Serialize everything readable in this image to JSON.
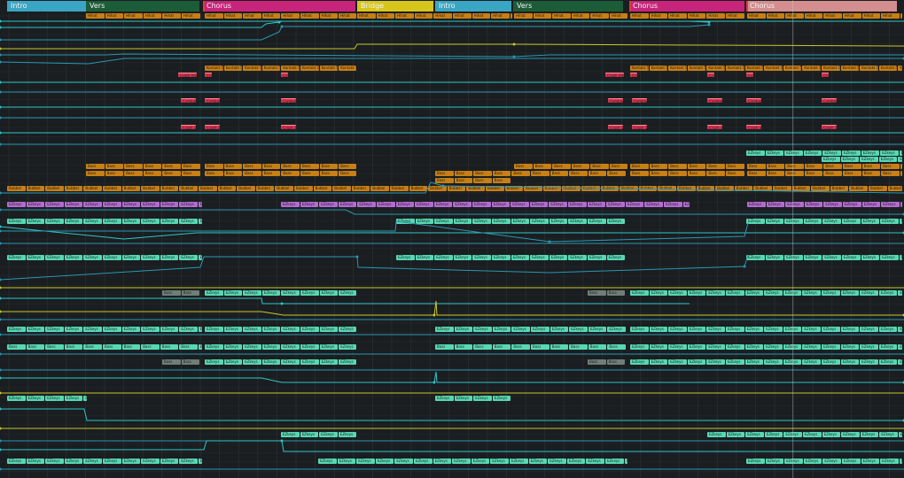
{
  "app": {
    "view": "arrangement",
    "colors": {
      "background": "#1a1e21",
      "lane_line": "#262b2e",
      "bar_line": "#2d3336",
      "orange_clip": "#c87f14",
      "red_clip": "#e0304f",
      "purple_clip": "#b56bd3",
      "teal_clip": "#56d9b3",
      "grey_clip": "#6f7f78",
      "auto_blue": "#2a97b3",
      "auto_teal": "#2fc6c6",
      "auto_yellow": "#c9c72a"
    }
  },
  "markers": [
    {
      "label": "Intro",
      "color": "#3aa6c3"
    },
    {
      "label": "Vers",
      "color": "#1d5c39"
    },
    {
      "label": "Chorus",
      "color": "#c9247c"
    },
    {
      "label": "Bridge",
      "color": "#d6c61c"
    },
    {
      "label": "Intro",
      "color": "#3aa6c3"
    },
    {
      "label": "Vers",
      "color": "#1d5c39"
    },
    {
      "label": "Chorus",
      "color": "#c9247c"
    },
    {
      "label": "Chorus",
      "color": "#d48e90"
    }
  ],
  "clip_labels": {
    "hihat": "Hihat",
    "kontakt": "Kontakt 5",
    "crash": "Crash 3",
    "crash_intro": "Crash Intr",
    "cymbal": "Cymbal",
    "bass": "Bass",
    "kickbass": "Kickbass",
    "kick": "Bubbel",
    "ezkeys": "EZkeys",
    "ezkeys_short": "EZkeys"
  }
}
